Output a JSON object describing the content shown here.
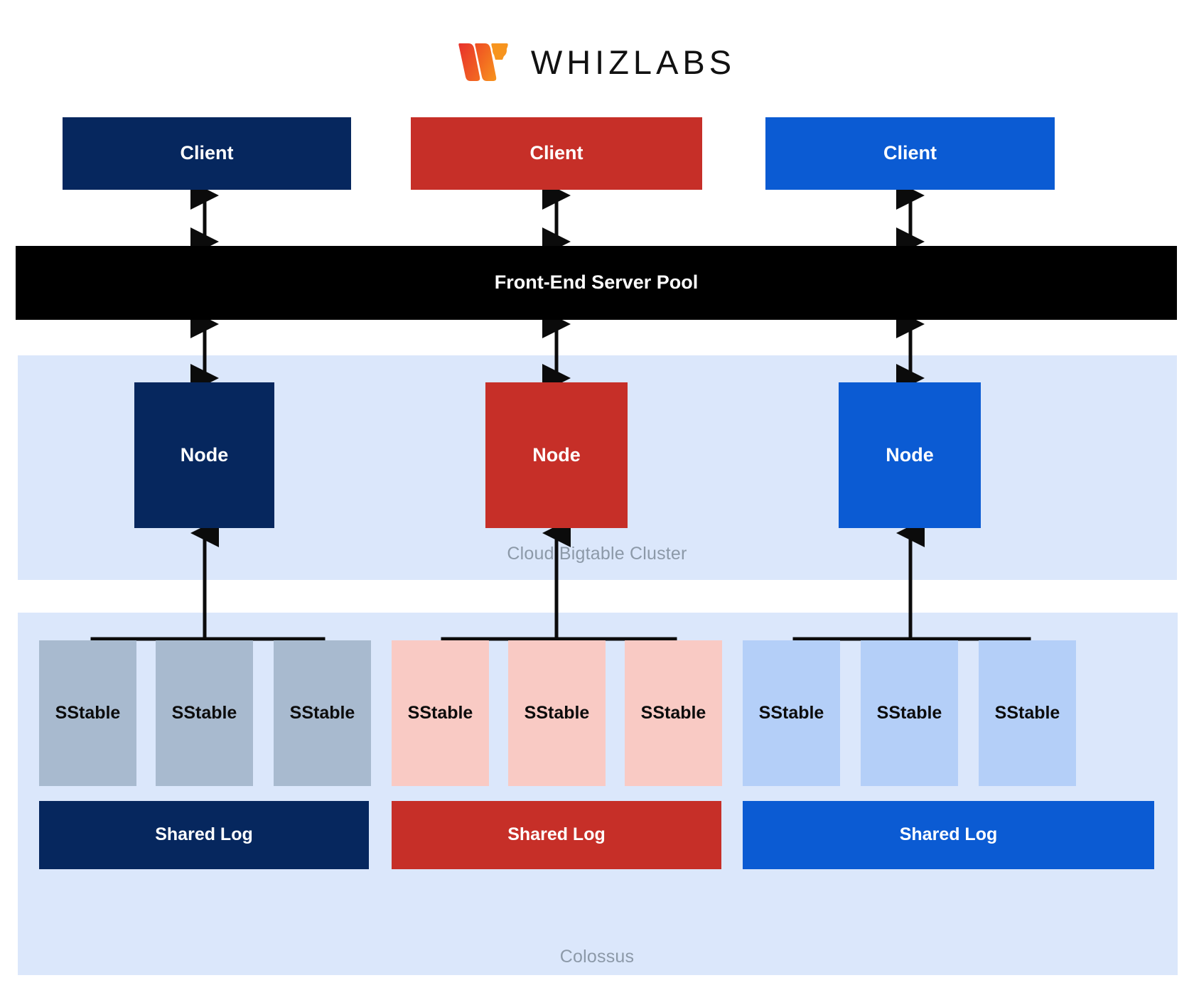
{
  "brand": {
    "name": "WHIZLABS",
    "logo_icon": "whizlabs-w-mark",
    "gradient_from": "#E8312B",
    "gradient_to": "#F58220"
  },
  "colors": {
    "navy": "#06275E",
    "red": "#C62F28",
    "blue": "#0B5BD3",
    "black": "#000000",
    "panel": "#DBE7FB",
    "panel_label": "#8C99A8",
    "sstable_navy": "#A8BACF",
    "sstable_red": "#F9CAC4",
    "sstable_blue": "#B4CFF8",
    "wire": "#0B0B0B"
  },
  "diagram": {
    "clients": [
      {
        "label": "Client",
        "color": "#06275E"
      },
      {
        "label": "Client",
        "color": "#C62F28"
      },
      {
        "label": "Client",
        "color": "#0B5BD3"
      }
    ],
    "front_end": {
      "label": "Front-End Server Pool",
      "color": "#000000"
    },
    "cluster_region": {
      "label": "Cloud Bigtable Cluster"
    },
    "storage_region": {
      "label": "Colossus"
    },
    "nodes": [
      {
        "label": "Node",
        "color": "#06275E"
      },
      {
        "label": "Node",
        "color": "#C62F28"
      },
      {
        "label": "Node",
        "color": "#0B5BD3"
      }
    ],
    "sstable_groups": [
      {
        "color": "#A8BACF",
        "items": [
          {
            "label": "SStable"
          },
          {
            "label": "SStable"
          },
          {
            "label": "SStable"
          }
        ]
      },
      {
        "color": "#F9CAC4",
        "items": [
          {
            "label": "SStable"
          },
          {
            "label": "SStable"
          },
          {
            "label": "SStable"
          }
        ]
      },
      {
        "color": "#B4CFF8",
        "items": [
          {
            "label": "SStable"
          },
          {
            "label": "SStable"
          },
          {
            "label": "SStable"
          }
        ]
      }
    ],
    "shared_logs": [
      {
        "label": "Shared Log",
        "color": "#06275E"
      },
      {
        "label": "Shared Log",
        "color": "#C62F28"
      },
      {
        "label": "Shared Log",
        "color": "#0B5BD3"
      }
    ]
  }
}
